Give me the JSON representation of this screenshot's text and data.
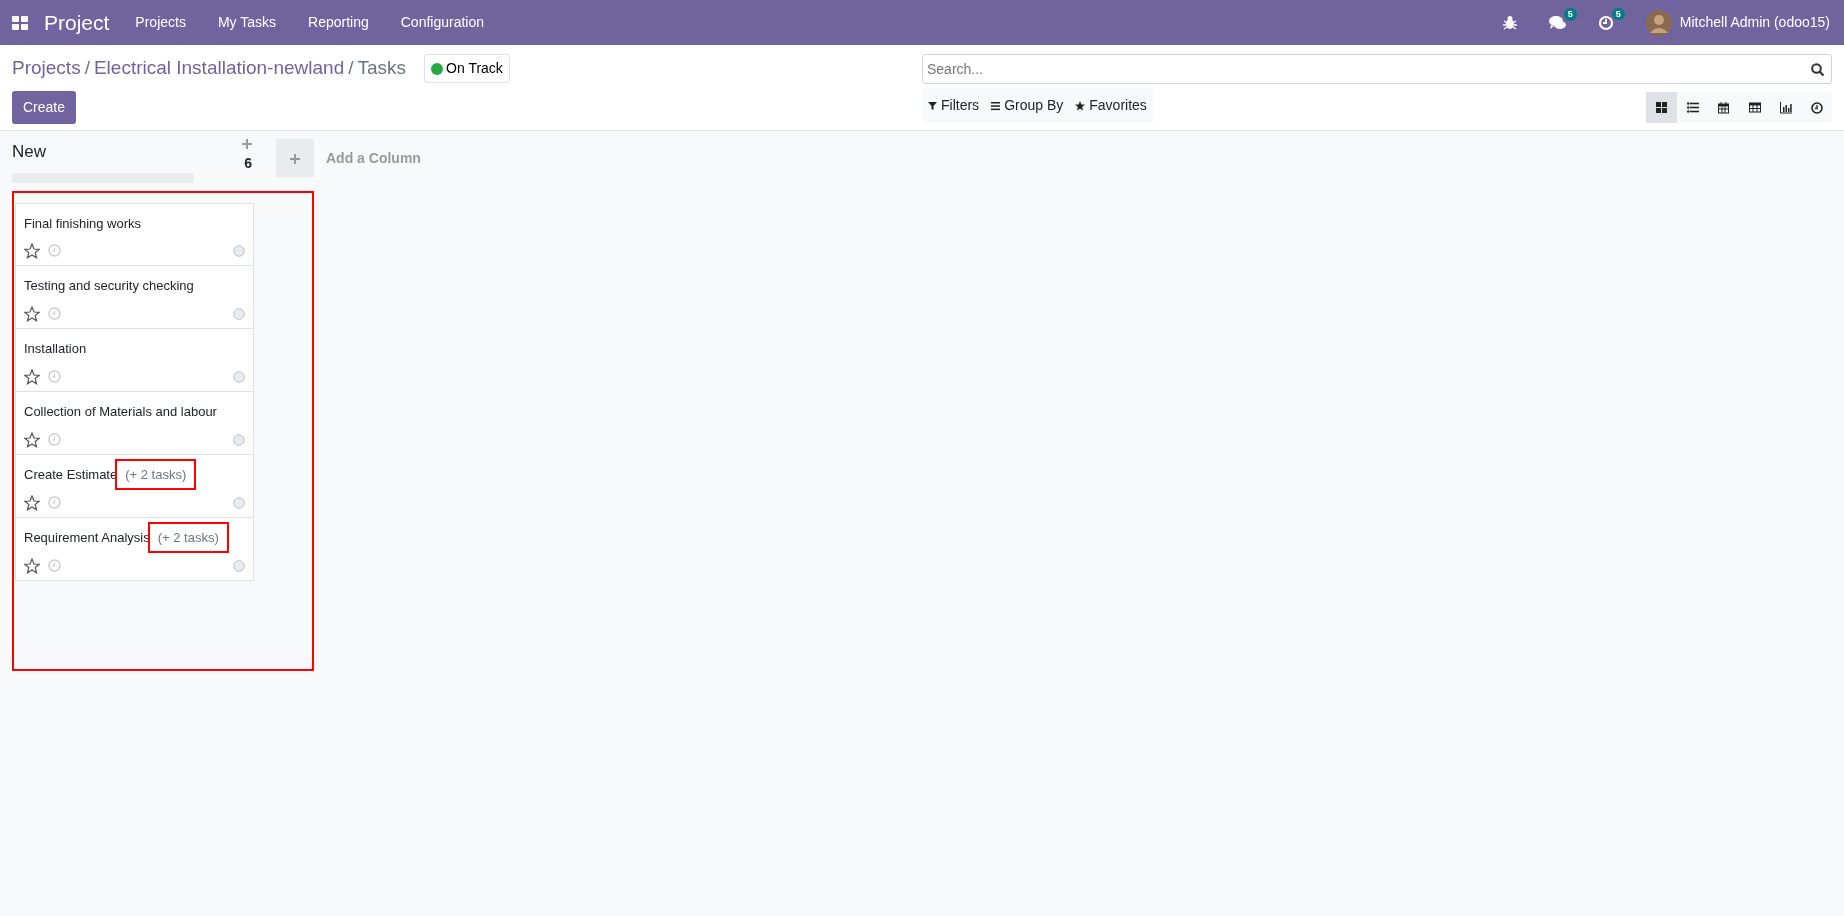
{
  "navbar": {
    "app_title": "Project",
    "menu": [
      "Projects",
      "My Tasks",
      "Reporting",
      "Configuration"
    ],
    "systray": [
      {
        "kind": "bug"
      },
      {
        "kind": "chat",
        "badge": "5"
      },
      {
        "kind": "activity",
        "badge": "5"
      }
    ],
    "user": "Mitchell Admin (odoo15)"
  },
  "breadcrumb": [
    {
      "label": "Projects",
      "link": true
    },
    {
      "separator": "/",
      "label": "Electrical Installation-newland",
      "link": true
    },
    {
      "separator": "/",
      "label": "Tasks",
      "link": false
    }
  ],
  "status": {
    "label": "On Track",
    "color": "#28a745"
  },
  "create_button": "Create",
  "search": {
    "placeholder": "Search..."
  },
  "search_options": [
    {
      "kind": "filter",
      "label": "Filters"
    },
    {
      "kind": "group",
      "label": "Group By"
    },
    {
      "kind": "favorite",
      "label": "Favorites"
    }
  ],
  "views": [
    {
      "kind": "kanban",
      "selected": true
    },
    {
      "kind": "list",
      "selected": false
    },
    {
      "kind": "calendar",
      "selected": false
    },
    {
      "kind": "pivot",
      "selected": false
    },
    {
      "kind": "graph",
      "selected": false
    },
    {
      "kind": "activity",
      "selected": false
    }
  ],
  "column": {
    "title": "New",
    "count": "6",
    "level": 0,
    "highlighted": true,
    "cards": [
      {
        "title": "Final finishing works",
        "starred": false
      },
      {
        "title": "Testing and security checking",
        "starred": false
      },
      {
        "title": "Installation",
        "starred": false
      },
      {
        "title": "Collection of Materials and labour",
        "starred": false
      },
      {
        "title": "Create Estimate",
        "subtasks": {
          "text": "(+ 2 tasks)",
          "highlighted": true
        },
        "starred": false
      },
      {
        "title": "Requirement Analysis",
        "subtasks": {
          "text": "(+ 2 tasks)",
          "highlighted": true
        },
        "starred": false
      }
    ]
  },
  "add_column": "Add a Column"
}
